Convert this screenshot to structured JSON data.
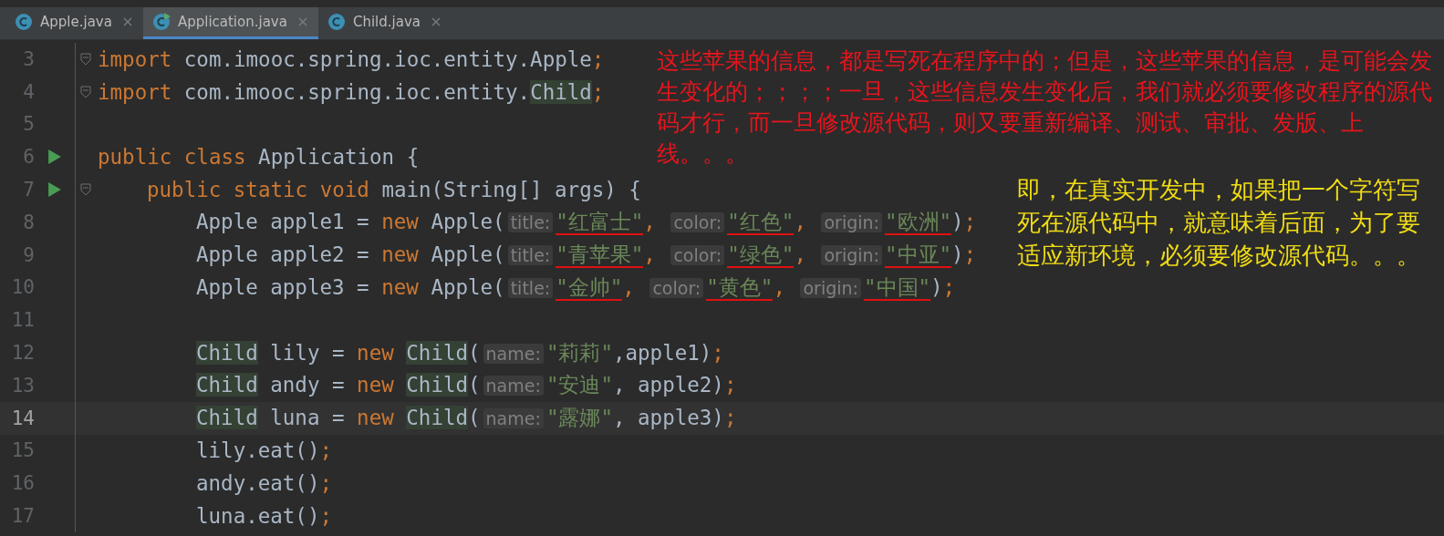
{
  "tabs": [
    {
      "label": "Apple.java",
      "selected": false,
      "runnable": false
    },
    {
      "label": "Application.java",
      "selected": true,
      "runnable": true
    },
    {
      "label": "Child.java",
      "selected": false,
      "runnable": false
    }
  ],
  "editor": {
    "lines": [
      {
        "number": "3",
        "run": false,
        "fold": true,
        "current": false,
        "tokens": [
          {
            "kind": "keyword",
            "text": "import"
          },
          {
            "kind": "plain",
            "text": " com.imooc.spring.ioc.entity.Apple"
          },
          {
            "kind": "punct",
            "text": ";"
          }
        ]
      },
      {
        "number": "4",
        "run": false,
        "fold": true,
        "current": false,
        "tokens": [
          {
            "kind": "keyword",
            "text": "import"
          },
          {
            "kind": "plain",
            "text": " com.imooc.spring.ioc.entity."
          },
          {
            "kind": "classref",
            "text": "Child"
          },
          {
            "kind": "punct",
            "text": ";"
          }
        ]
      },
      {
        "number": "5",
        "run": false,
        "fold": false,
        "current": false
      },
      {
        "number": "6",
        "run": true,
        "fold": false,
        "current": false,
        "tokens": [
          {
            "kind": "keyword",
            "text": "public class"
          },
          {
            "kind": "plain",
            "text": " Application {"
          }
        ],
        "children": [
          {
            "number": "7",
            "run": true,
            "fold": true,
            "current": false,
            "tokens": [
              {
                "kind": "keyword",
                "text": "public static void"
              },
              {
                "kind": "plain",
                "text": " main(String[] args) {"
              }
            ],
            "children": [
              {
                "number": "8",
                "run": false,
                "fold": false,
                "current": false,
                "tokens": [
                  {
                    "kind": "plain",
                    "text": "Apple apple1 = "
                  },
                  {
                    "kind": "keyword",
                    "text": "new"
                  },
                  {
                    "kind": "plain",
                    "text": " Apple("
                  },
                  {
                    "kind": "hint",
                    "text": "title:"
                  },
                  {
                    "kind": "string",
                    "text": "\"红富士\"",
                    "underlined": true
                  },
                  {
                    "kind": "punct",
                    "text": ", "
                  },
                  {
                    "kind": "hint",
                    "text": "color:"
                  },
                  {
                    "kind": "string",
                    "text": "\"红色\"",
                    "underlined": true
                  },
                  {
                    "kind": "punct",
                    "text": ", "
                  },
                  {
                    "kind": "hint",
                    "text": "origin:"
                  },
                  {
                    "kind": "string",
                    "text": "\"欧洲\"",
                    "underlined": true
                  },
                  {
                    "kind": "plain",
                    "text": ")"
                  },
                  {
                    "kind": "punct",
                    "text": ";"
                  }
                ]
              },
              {
                "number": "9",
                "run": false,
                "fold": false,
                "current": false,
                "tokens": [
                  {
                    "kind": "plain",
                    "text": "Apple apple2 = "
                  },
                  {
                    "kind": "keyword",
                    "text": "new"
                  },
                  {
                    "kind": "plain",
                    "text": " Apple("
                  },
                  {
                    "kind": "hint",
                    "text": "title:"
                  },
                  {
                    "kind": "string",
                    "text": "\"青苹果\"",
                    "underlined": true
                  },
                  {
                    "kind": "punct",
                    "text": ", "
                  },
                  {
                    "kind": "hint",
                    "text": "color:"
                  },
                  {
                    "kind": "string",
                    "text": "\"绿色\"",
                    "underlined": true
                  },
                  {
                    "kind": "punct",
                    "text": ", "
                  },
                  {
                    "kind": "hint",
                    "text": "origin:"
                  },
                  {
                    "kind": "string",
                    "text": "\"中亚\"",
                    "underlined": true
                  },
                  {
                    "kind": "plain",
                    "text": ")"
                  },
                  {
                    "kind": "punct",
                    "text": ";"
                  }
                ]
              },
              {
                "number": "10",
                "run": false,
                "fold": false,
                "current": false,
                "tokens": [
                  {
                    "kind": "plain",
                    "text": "Apple apple3 = "
                  },
                  {
                    "kind": "keyword",
                    "text": "new"
                  },
                  {
                    "kind": "plain",
                    "text": " Apple("
                  },
                  {
                    "kind": "hint",
                    "text": "title:"
                  },
                  {
                    "kind": "string",
                    "text": "\"金帅\"",
                    "underlined": true
                  },
                  {
                    "kind": "punct",
                    "text": ", "
                  },
                  {
                    "kind": "hint",
                    "text": "color:"
                  },
                  {
                    "kind": "string",
                    "text": "\"黄色\"",
                    "underlined": true
                  },
                  {
                    "kind": "punct",
                    "text": ", "
                  },
                  {
                    "kind": "hint",
                    "text": "origin:"
                  },
                  {
                    "kind": "string",
                    "text": "\"中国\"",
                    "underlined": true
                  },
                  {
                    "kind": "plain",
                    "text": ")"
                  },
                  {
                    "kind": "punct",
                    "text": ";"
                  }
                ]
              },
              {
                "number": "11",
                "run": false,
                "fold": false,
                "current": false
              },
              {
                "number": "12",
                "run": false,
                "fold": false,
                "current": false,
                "tokens": [
                  {
                    "kind": "classref",
                    "text": "Child"
                  },
                  {
                    "kind": "plain",
                    "text": " lily = "
                  },
                  {
                    "kind": "keyword",
                    "text": "new "
                  },
                  {
                    "kind": "classref",
                    "text": "Child"
                  },
                  {
                    "kind": "plain",
                    "text": "("
                  },
                  {
                    "kind": "hint",
                    "text": "name:"
                  },
                  {
                    "kind": "string",
                    "text": "\"莉莉\"",
                    "underlined": false
                  },
                  {
                    "kind": "plain",
                    "text": ",apple1)"
                  },
                  {
                    "kind": "punct",
                    "text": ";"
                  }
                ]
              },
              {
                "number": "13",
                "run": false,
                "fold": false,
                "current": false,
                "tokens": [
                  {
                    "kind": "classref",
                    "text": "Child"
                  },
                  {
                    "kind": "plain",
                    "text": " andy = "
                  },
                  {
                    "kind": "keyword",
                    "text": "new "
                  },
                  {
                    "kind": "classref",
                    "text": "Child"
                  },
                  {
                    "kind": "plain",
                    "text": "("
                  },
                  {
                    "kind": "hint",
                    "text": "name:"
                  },
                  {
                    "kind": "string",
                    "text": "\"安迪\"",
                    "underlined": false
                  },
                  {
                    "kind": "plain",
                    "text": ", apple2)"
                  },
                  {
                    "kind": "punct",
                    "text": ";"
                  }
                ]
              },
              {
                "number": "14",
                "run": false,
                "fold": false,
                "current": true,
                "tokens": [
                  {
                    "kind": "classref",
                    "text": "Child"
                  },
                  {
                    "kind": "plain",
                    "text": " luna = "
                  },
                  {
                    "kind": "keyword",
                    "text": "new "
                  },
                  {
                    "kind": "classref",
                    "text": "Child"
                  },
                  {
                    "kind": "plain",
                    "text": "("
                  },
                  {
                    "kind": "hint",
                    "text": "name:"
                  },
                  {
                    "kind": "string",
                    "text": "\"露娜\"",
                    "underlined": false
                  },
                  {
                    "kind": "plain",
                    "text": ", apple3)"
                  },
                  {
                    "kind": "punct",
                    "text": ";"
                  }
                ]
              },
              {
                "number": "15",
                "run": false,
                "fold": false,
                "current": false,
                "tokens": [
                  {
                    "kind": "plain",
                    "text": "lily.eat()"
                  },
                  {
                    "kind": "punct",
                    "text": ";"
                  }
                ]
              },
              {
                "number": "16",
                "run": false,
                "fold": false,
                "current": false,
                "tokens": [
                  {
                    "kind": "plain",
                    "text": "andy.eat()"
                  },
                  {
                    "kind": "punct",
                    "text": ";"
                  }
                ]
              },
              {
                "number": "17",
                "run": false,
                "fold": false,
                "current": false,
                "tokens": [
                  {
                    "kind": "plain",
                    "text": "luna.eat()"
                  },
                  {
                    "kind": "punct",
                    "text": ";"
                  }
                ]
              }
            ]
          }
        ]
      }
    ]
  },
  "annotations": [
    {
      "kind": "red",
      "text": "这些苹果的信息，都是写死在程序中的；但是，这些苹果的信息，是可能会发生变化的；；；；一旦，这些信息发生变化后，我们就必须要修改程序的源代码才行，而一旦修改源代码，则又要重新编译、测试、审批、发版、上线。。。"
    },
    {
      "kind": "yellow",
      "text": "即，在真实开发中，如果把一个字符写死在源代码中，就意味着后面，为了要适应新环境，必须要修改源代码。。。"
    }
  ]
}
